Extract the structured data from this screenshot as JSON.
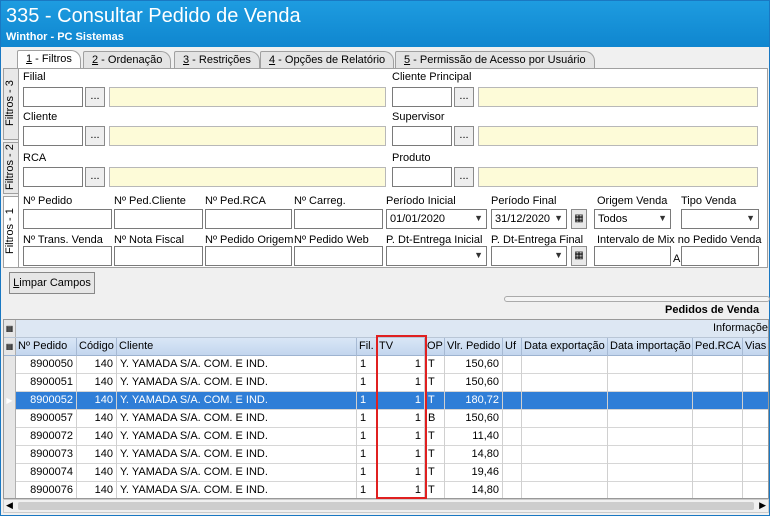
{
  "window": {
    "title": "335 - Consultar Pedido de Venda",
    "subtitle": "Winthor - PC Sistemas"
  },
  "tabs": [
    {
      "num": "1",
      "label": " - Filtros"
    },
    {
      "num": "2",
      "label": " - Ordenação"
    },
    {
      "num": "3",
      "label": " - Restrições"
    },
    {
      "num": "4",
      "label": " - Opções de Relatório"
    },
    {
      "num": "5",
      "label": " - Permissão de Acesso por Usuário"
    }
  ],
  "side_tabs": [
    "Filtros - 3",
    "Filtros - 2",
    "Filtros - 1"
  ],
  "filters": {
    "filial": "Filial",
    "cliente_principal": "Cliente Principal",
    "cliente": "Cliente",
    "supervisor": "Supervisor",
    "rca": "RCA",
    "produto": "Produto",
    "ellipsis": "...",
    "num_pedido": "Nº Pedido",
    "num_ped_cliente": "Nº Ped.Cliente",
    "num_ped_rca": "Nº Ped.RCA",
    "num_carreg": "Nº Carreg.",
    "periodo_inicial": "Período Inicial",
    "periodo_inicial_value": "01/01/2020",
    "periodo_final": "Período Final",
    "periodo_final_value": "31/12/2020",
    "origem_venda": "Origem Venda",
    "origem_venda_value": "Todos",
    "tipo_venda": "Tipo Venda",
    "num_trans_venda": "Nº Trans. Venda",
    "num_nota_fiscal": "Nº Nota Fiscal",
    "num_pedido_origem": "Nº Pedido Origem",
    "num_pedido_web": "Nº Pedido Web",
    "p_dt_entrega_inicial": "P. Dt-Entrega Inicial",
    "p_dt_entrega_final": "P. Dt-Entrega Final",
    "intervalo_mix": "Intervalo de Mix no Pedido Venda",
    "intervalo_a": "A"
  },
  "buttons": {
    "limpar": "Limpar Campos"
  },
  "grid": {
    "section_title": "Pedidos de  Venda",
    "group_info": "Informaçõe",
    "columns": [
      "Nº Pedido",
      "Código",
      "Cliente",
      "Fil.",
      "TV",
      "OP",
      "Vlr. Pedido",
      "Uf",
      "Data exportação",
      "Data importação",
      "Ped.RCA",
      "Vias"
    ],
    "rows": [
      {
        "pedido": "8900050",
        "codigo": "140",
        "cliente": "Y. YAMADA S/A. COM. E IND.",
        "fil": "1",
        "tv": "1",
        "op": "T",
        "valor": "150,60"
      },
      {
        "pedido": "8900051",
        "codigo": "140",
        "cliente": "Y. YAMADA S/A. COM. E IND.",
        "fil": "1",
        "tv": "1",
        "op": "T",
        "valor": "150,60"
      },
      {
        "pedido": "8900052",
        "codigo": "140",
        "cliente": "Y. YAMADA S/A. COM. E IND.",
        "fil": "1",
        "tv": "1",
        "op": "T",
        "valor": "180,72"
      },
      {
        "pedido": "8900057",
        "codigo": "140",
        "cliente": "Y. YAMADA S/A. COM. E IND.",
        "fil": "1",
        "tv": "1",
        "op": "B",
        "valor": "150,60"
      },
      {
        "pedido": "8900072",
        "codigo": "140",
        "cliente": "Y. YAMADA S/A. COM. E IND.",
        "fil": "1",
        "tv": "1",
        "op": "T",
        "valor": "11,40"
      },
      {
        "pedido": "8900073",
        "codigo": "140",
        "cliente": "Y. YAMADA S/A. COM. E IND.",
        "fil": "1",
        "tv": "1",
        "op": "T",
        "valor": "14,80"
      },
      {
        "pedido": "8900074",
        "codigo": "140",
        "cliente": "Y. YAMADA S/A. COM. E IND.",
        "fil": "1",
        "tv": "1",
        "op": "T",
        "valor": "19,46"
      },
      {
        "pedido": "8900076",
        "codigo": "140",
        "cliente": "Y. YAMADA S/A. COM. E IND.",
        "fil": "1",
        "tv": "1",
        "op": "T",
        "valor": "14,80"
      }
    ]
  },
  "colors": {
    "title_bar": "#1693d9",
    "selected_row": "#2f7ed7",
    "highlight_box": "#e02020"
  }
}
